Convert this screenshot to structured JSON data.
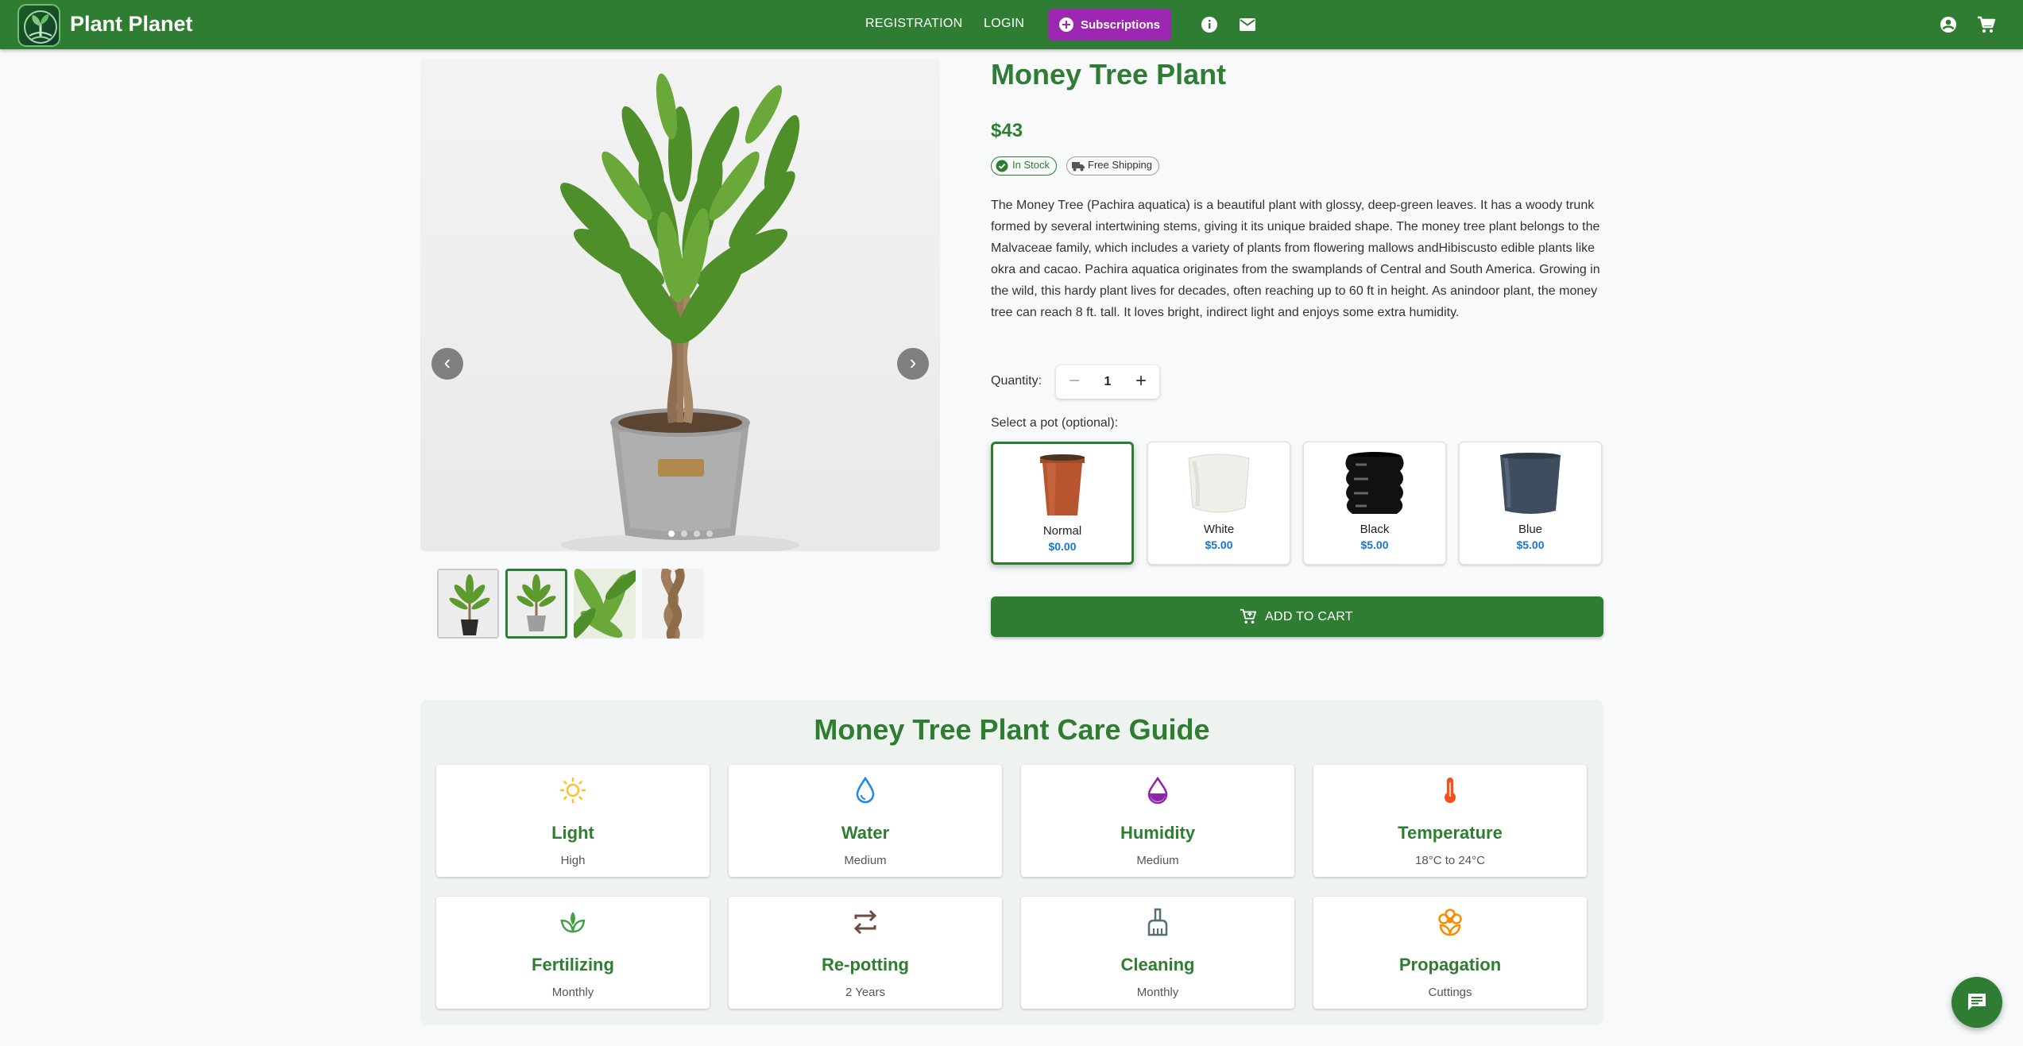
{
  "header": {
    "brand": "Plant Planet",
    "nav": {
      "registration": "REGISTRATION",
      "login": "LOGIN",
      "subscriptions": "Subscriptions"
    },
    "icons": [
      "info-icon",
      "mail-icon",
      "account-icon",
      "cart-icon"
    ],
    "color": "#2e7d32",
    "subscriptions_color": "#9c27b0"
  },
  "gallery": {
    "prev": "‹",
    "next": "›",
    "image_count": 4,
    "active_image": 1,
    "thumbnails": [
      "plant-black-pot",
      "plant-grey-pot",
      "leaves-closeup",
      "braided-trunk"
    ]
  },
  "product": {
    "title": "Money Tree Plant",
    "price": "$43",
    "badges": {
      "stock": "In Stock",
      "shipping": "Free Shipping"
    },
    "description": "The Money Tree (Pachira aquatica) is a beautiful plant with glossy, deep-green leaves. It has a woody trunk formed by several intertwining stems, giving it its unique braided shape. The money tree plant belongs to the Malvaceae family, which includes a variety of plants from flowering mallows andHibiscusto edible plants like okra and cacao. Pachira aquatica originates from the swamplands of Central and South America. Growing in the wild, this hardy plant lives for decades, often reaching up to 60 ft in height. As anindoor plant, the money tree can reach 8 ft. tall. It loves bright, indirect light and enjoys some extra humidity.",
    "quantity_label": "Quantity:",
    "quantity": "1",
    "pot_label": "Select a pot (optional):",
    "pots": [
      {
        "name": "Normal",
        "price": "$0.00",
        "selected": true,
        "color": "#b8552f"
      },
      {
        "name": "White",
        "price": "$5.00",
        "selected": false,
        "color": "#f1efea"
      },
      {
        "name": "Black",
        "price": "$5.00",
        "selected": false,
        "color": "#111111"
      },
      {
        "name": "Blue",
        "price": "$5.00",
        "selected": false,
        "color": "#3f4e5f"
      }
    ],
    "add_to_cart": "ADD TO CART"
  },
  "care_guide": {
    "title": "Money Tree Plant Care Guide",
    "items": [
      {
        "title": "Light",
        "value": "High",
        "icon": "sun-icon",
        "color": "#fbc02d"
      },
      {
        "title": "Water",
        "value": "Medium",
        "icon": "water-drop-icon",
        "color": "#1e88e5"
      },
      {
        "title": "Humidity",
        "value": "Medium",
        "icon": "humidity-icon",
        "color": "#8e24aa"
      },
      {
        "title": "Temperature",
        "value": "18°C to 24°C",
        "icon": "thermometer-icon",
        "color": "#f4511e"
      },
      {
        "title": "Fertilizing",
        "value": "Monthly",
        "icon": "sprout-icon",
        "color": "#43a047"
      },
      {
        "title": "Re-potting",
        "value": "2 Years",
        "icon": "repeat-icon",
        "color": "#6d4c41"
      },
      {
        "title": "Cleaning",
        "value": "Monthly",
        "icon": "broom-icon",
        "color": "#546e7a"
      },
      {
        "title": "Propagation",
        "value": "Cuttings",
        "icon": "flower-icon",
        "color": "#fb8c00"
      }
    ]
  },
  "chat": {
    "icon": "chat-icon"
  }
}
